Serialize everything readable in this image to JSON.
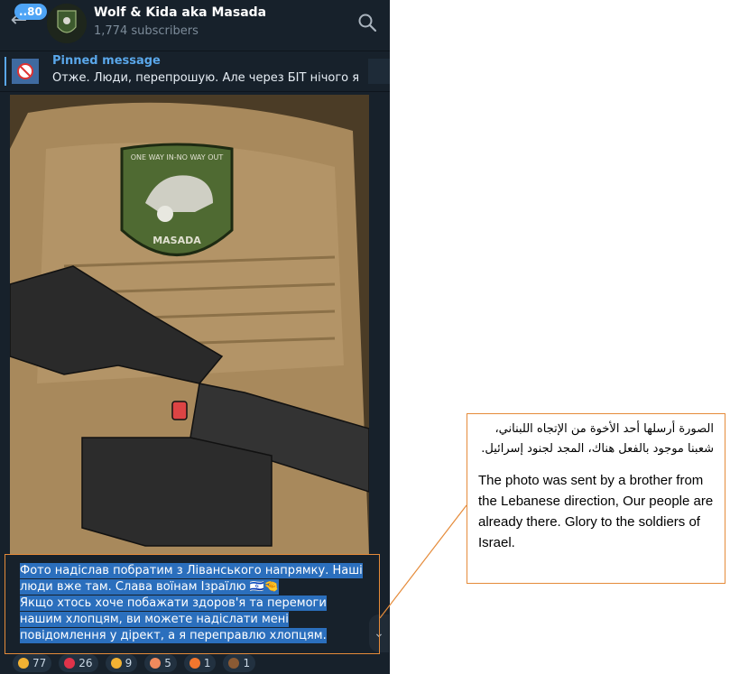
{
  "header": {
    "back_icon": "arrow-left-icon",
    "unread_badge": "..80",
    "channel_title": "Wolf & Kida aka Masada",
    "subscribers": "1,774 subscribers",
    "search_icon": "search-icon"
  },
  "pinned": {
    "title": "Pinned message",
    "text": "Отже. Люди, перепрошую. Але через БІТ нічого я ..."
  },
  "photo": {
    "patch_top": "ONE WAY IN-NO WAY OUT",
    "patch_bottom": "MASADA"
  },
  "caption": {
    "line1": "Фото надіслав побратим з Ліванського напрямку. Наші люди вже там. Слава воїнам Ізраїлю 🇮🇱🤏",
    "line2": "Якщо хтось хоче побажати здоров'я та перемоги нашим хлопцям, ви можете надіслати мені повідомлення у дірект, а я переправлю хлопцям."
  },
  "reactions": [
    {
      "emoji": "🙏",
      "count": "77",
      "color": "#f2b233"
    },
    {
      "emoji": "❤",
      "count": "26",
      "color": "#e0334a"
    },
    {
      "emoji": "👍",
      "count": "9",
      "color": "#f2b233"
    },
    {
      "emoji": "🥰",
      "count": "5",
      "color": "#f08a5d"
    },
    {
      "emoji": "🔥",
      "count": "1",
      "color": "#f2762e"
    },
    {
      "emoji": "💩",
      "count": "1",
      "color": "#8a5a34"
    }
  ],
  "callout": {
    "arabic": "الصورة أرسلها أحد الأخوة من الإتجاه اللبناني، شعبنا موجود بالفعل هناك، المجد لجنود إسرائيل.",
    "english": "The photo was sent by a brother from the Lebanese direction, Our people are already there. Glory to the soldiers of Israel."
  },
  "colors": {
    "telegram_bg": "#17212b",
    "accent_blue": "#5aa7ea",
    "selection": "#2b6fbd",
    "annotation_orange": "#e58b3a"
  }
}
